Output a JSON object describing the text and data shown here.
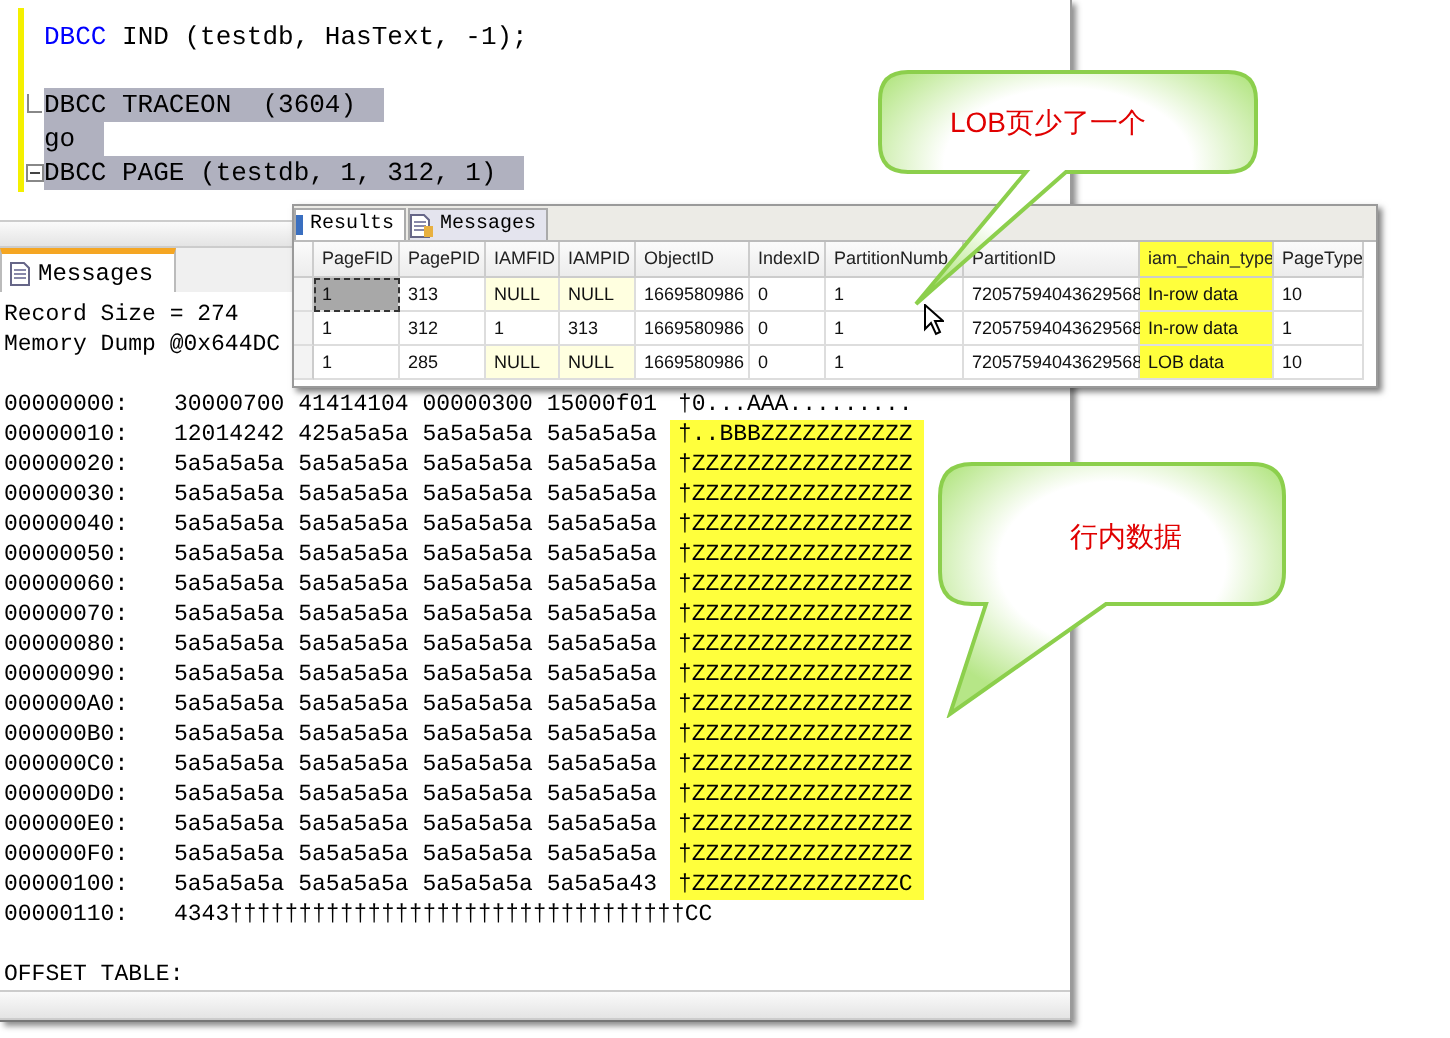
{
  "editor": {
    "lines": [
      {
        "keyword": "DBCC",
        "text": " IND (testdb, HasText, -1);",
        "selected": false,
        "gap_before": false,
        "kind": "plain"
      },
      {
        "text": "DBCC TRACEON  (3604)",
        "selected": true,
        "gap_before": true,
        "kind": "fold-end"
      },
      {
        "text": "go",
        "selected": true,
        "gap_before": false,
        "kind": "plain"
      },
      {
        "text": "DBCC PAGE (testdb, 1, 312, 1)",
        "selected": true,
        "gap_before": false,
        "kind": "fold-start"
      }
    ]
  },
  "messages": {
    "tab": {
      "label": "Messages",
      "selected": true
    },
    "header_lines": [
      "Record Size = 274",
      "Memory Dump @0x644DC"
    ],
    "rows": [
      {
        "offset": "00000000:",
        "hex": "30000700 41414104 00000300 15000f01",
        "ascii": "†0...AAA.........",
        "highlighted": false
      },
      {
        "offset": "00000010:",
        "hex": "12014242 425a5a5a 5a5a5a5a 5a5a5a5a",
        "ascii": "†..BBBZZZZZZZZZZZ",
        "highlighted": true
      },
      {
        "offset": "00000020:",
        "hex": "5a5a5a5a 5a5a5a5a 5a5a5a5a 5a5a5a5a",
        "ascii": "†ZZZZZZZZZZZZZZZZ",
        "highlighted": true
      },
      {
        "offset": "00000030:",
        "hex": "5a5a5a5a 5a5a5a5a 5a5a5a5a 5a5a5a5a",
        "ascii": "†ZZZZZZZZZZZZZZZZ",
        "highlighted": true
      },
      {
        "offset": "00000040:",
        "hex": "5a5a5a5a 5a5a5a5a 5a5a5a5a 5a5a5a5a",
        "ascii": "†ZZZZZZZZZZZZZZZZ",
        "highlighted": true
      },
      {
        "offset": "00000050:",
        "hex": "5a5a5a5a 5a5a5a5a 5a5a5a5a 5a5a5a5a",
        "ascii": "†ZZZZZZZZZZZZZZZZ",
        "highlighted": true
      },
      {
        "offset": "00000060:",
        "hex": "5a5a5a5a 5a5a5a5a 5a5a5a5a 5a5a5a5a",
        "ascii": "†ZZZZZZZZZZZZZZZZ",
        "highlighted": true
      },
      {
        "offset": "00000070:",
        "hex": "5a5a5a5a 5a5a5a5a 5a5a5a5a 5a5a5a5a",
        "ascii": "†ZZZZZZZZZZZZZZZZ",
        "highlighted": true
      },
      {
        "offset": "00000080:",
        "hex": "5a5a5a5a 5a5a5a5a 5a5a5a5a 5a5a5a5a",
        "ascii": "†ZZZZZZZZZZZZZZZZ",
        "highlighted": true
      },
      {
        "offset": "00000090:",
        "hex": "5a5a5a5a 5a5a5a5a 5a5a5a5a 5a5a5a5a",
        "ascii": "†ZZZZZZZZZZZZZZZZ",
        "highlighted": true
      },
      {
        "offset": "000000A0:",
        "hex": "5a5a5a5a 5a5a5a5a 5a5a5a5a 5a5a5a5a",
        "ascii": "†ZZZZZZZZZZZZZZZZ",
        "highlighted": true
      },
      {
        "offset": "000000B0:",
        "hex": "5a5a5a5a 5a5a5a5a 5a5a5a5a 5a5a5a5a",
        "ascii": "†ZZZZZZZZZZZZZZZZ",
        "highlighted": true
      },
      {
        "offset": "000000C0:",
        "hex": "5a5a5a5a 5a5a5a5a 5a5a5a5a 5a5a5a5a",
        "ascii": "†ZZZZZZZZZZZZZZZZ",
        "highlighted": true
      },
      {
        "offset": "000000D0:",
        "hex": "5a5a5a5a 5a5a5a5a 5a5a5a5a 5a5a5a5a",
        "ascii": "†ZZZZZZZZZZZZZZZZ",
        "highlighted": true
      },
      {
        "offset": "000000E0:",
        "hex": "5a5a5a5a 5a5a5a5a 5a5a5a5a 5a5a5a5a",
        "ascii": "†ZZZZZZZZZZZZZZZZ",
        "highlighted": true
      },
      {
        "offset": "000000F0:",
        "hex": "5a5a5a5a 5a5a5a5a 5a5a5a5a 5a5a5a5a",
        "ascii": "†ZZZZZZZZZZZZZZZZ",
        "highlighted": true
      },
      {
        "offset": "00000100:",
        "hex": "5a5a5a5a 5a5a5a5a 5a5a5a5a 5a5a5a43",
        "ascii": "†ZZZZZZZZZZZZZZZC",
        "highlighted": true
      },
      {
        "offset": "00000110:",
        "hex": "4343†††††††††††††††††††††††††††††††††CC",
        "ascii": ""
      }
    ],
    "footer": "OFFSET TABLE:"
  },
  "results": {
    "tabs": [
      {
        "label": "Results",
        "selected": true,
        "kind": "grid"
      },
      {
        "label": "Messages",
        "selected": false,
        "kind": "text"
      }
    ],
    "columns": [
      {
        "label": "PageFID",
        "highlighted": false
      },
      {
        "label": "PagePID",
        "highlighted": false
      },
      {
        "label": "IAMFID",
        "highlighted": false
      },
      {
        "label": "IAMPID",
        "highlighted": false
      },
      {
        "label": "ObjectID",
        "highlighted": false
      },
      {
        "label": "IndexID",
        "highlighted": false
      },
      {
        "label": "PartitionNumb",
        "highlighted": false
      },
      {
        "label": "PartitionID",
        "highlighted": false
      },
      {
        "label": "iam_chain_type",
        "highlighted": true
      },
      {
        "label": "PageType",
        "highlighted": false
      }
    ],
    "rows": [
      {
        "cells": [
          {
            "text": "1",
            "null": false,
            "selected": true
          },
          {
            "text": "313",
            "null": false,
            "selected": false
          },
          {
            "text": "NULL",
            "null": true,
            "selected": false
          },
          {
            "text": "NULL",
            "null": true,
            "selected": false
          },
          {
            "text": "1669580986",
            "null": false,
            "selected": false
          },
          {
            "text": "0",
            "null": false,
            "selected": false
          },
          {
            "text": "1",
            "null": false,
            "selected": false
          },
          {
            "text": "72057594043629568",
            "null": false,
            "selected": false
          },
          {
            "text": "In-row data",
            "null": false,
            "selected": false
          },
          {
            "text": "10",
            "null": false,
            "selected": false
          }
        ]
      },
      {
        "cells": [
          {
            "text": "1",
            "null": false,
            "selected": false
          },
          {
            "text": "312",
            "null": false,
            "selected": false
          },
          {
            "text": "1",
            "null": false,
            "selected": false
          },
          {
            "text": "313",
            "null": false,
            "selected": false
          },
          {
            "text": "1669580986",
            "null": false,
            "selected": false
          },
          {
            "text": "0",
            "null": false,
            "selected": false
          },
          {
            "text": "1",
            "null": false,
            "selected": false
          },
          {
            "text": "72057594043629568",
            "null": false,
            "selected": false
          },
          {
            "text": "In-row data",
            "null": false,
            "selected": false
          },
          {
            "text": "1",
            "null": false,
            "selected": false
          }
        ]
      },
      {
        "cells": [
          {
            "text": "1",
            "null": false,
            "selected": false
          },
          {
            "text": "285",
            "null": false,
            "selected": false
          },
          {
            "text": "NULL",
            "null": true,
            "selected": false
          },
          {
            "text": "NULL",
            "null": true,
            "selected": false
          },
          {
            "text": "1669580986",
            "null": false,
            "selected": false
          },
          {
            "text": "0",
            "null": false,
            "selected": false
          },
          {
            "text": "1",
            "null": false,
            "selected": false
          },
          {
            "text": "72057594043629568",
            "null": false,
            "selected": false
          },
          {
            "text": "LOB data",
            "null": false,
            "selected": false
          },
          {
            "text": "10",
            "null": false,
            "selected": false
          }
        ]
      }
    ]
  },
  "callouts": [
    {
      "text": "LOB页少了一个"
    },
    {
      "text": "行内数据"
    }
  ]
}
